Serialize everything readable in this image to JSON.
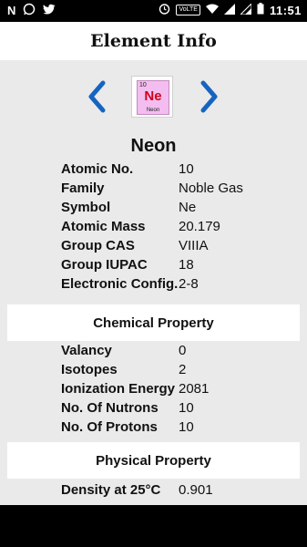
{
  "status_bar": {
    "left_icons": [
      "n-icon",
      "whatsapp-icon",
      "twitter-icon"
    ],
    "volte": "VoLTE",
    "time": "11:51"
  },
  "app_bar": {
    "title": "Element Info"
  },
  "element": {
    "number": "10",
    "symbol": "Ne",
    "name": "Neon",
    "tile_color": "#f3bdf0",
    "symbol_color": "#d0021b"
  },
  "info": [
    {
      "label": "Atomic No.",
      "value": "10"
    },
    {
      "label": "Family",
      "value": "Noble Gas"
    },
    {
      "label": "Symbol",
      "value": "Ne"
    },
    {
      "label": "Atomic Mass",
      "value": "20.179"
    },
    {
      "label": "Group CAS",
      "value": "VIIIA"
    },
    {
      "label": "Group IUPAC",
      "value": "18"
    },
    {
      "label": "Electronic Config.",
      "value": "2-8"
    }
  ],
  "chemical": {
    "title": "Chemical Property",
    "rows": [
      {
        "label": "Valancy",
        "value": "0"
      },
      {
        "label": "Isotopes",
        "value": "2"
      },
      {
        "label": "Ionization Energy",
        "value": "2081"
      },
      {
        "label": "No. Of Nutrons",
        "value": "10"
      },
      {
        "label": "No. Of Protons",
        "value": "10"
      }
    ]
  },
  "physical": {
    "title": "Physical Property",
    "rows": [
      {
        "label": "Density at 25°C",
        "value": "0.901"
      }
    ]
  },
  "colors": {
    "accent_arrow": "#1565c0",
    "background": "#eaeaea"
  }
}
